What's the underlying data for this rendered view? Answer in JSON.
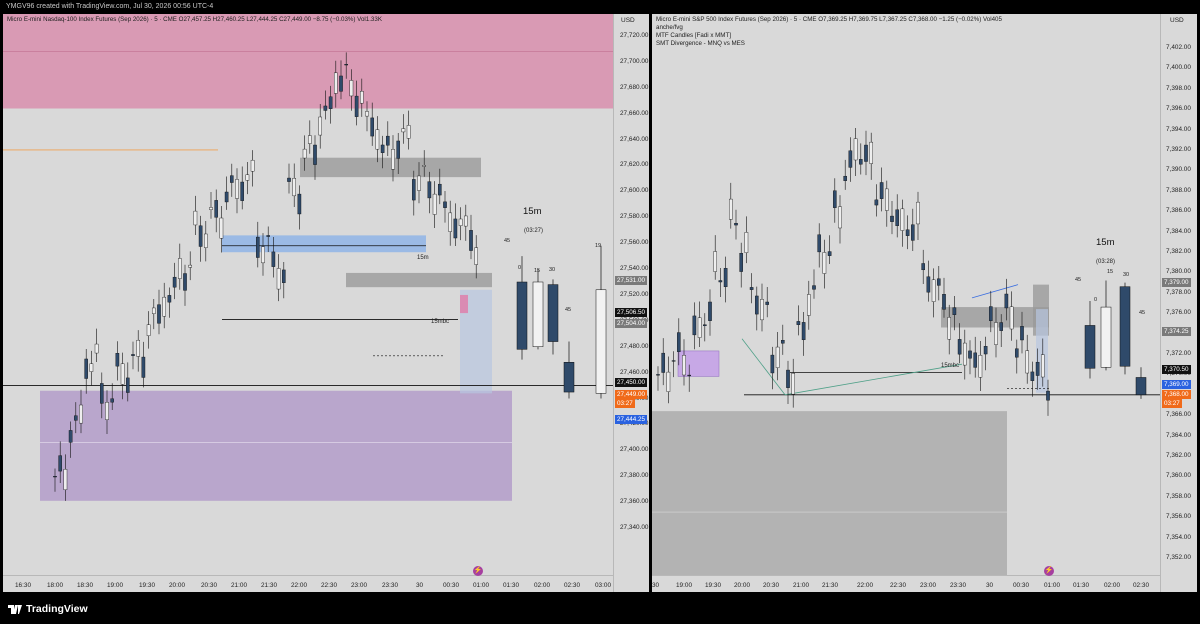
{
  "top_bar": {
    "caption": "YMGV96 created with TradingView.com, Jul 30, 2026 00:56 UTC-4"
  },
  "left_chart": {
    "title": "Micro E-mini Nasdaq-100 Index Futures (Sep 2026) · 5 · CME",
    "ohlc": "O27,457.25 H27,460.25 L27,444.25 C27,449.00 −8.75 (−0.03%) Vol1.33K",
    "currency": "USD",
    "y_labels": [
      "27,720.00",
      "27,700.00",
      "27,680.00",
      "27,660.00",
      "27,640.00",
      "27,620.00",
      "27,600.00",
      "27,580.00",
      "27,560.00",
      "27,540.00",
      "27,520.00",
      "27,500.00",
      "27,480.00",
      "27,460.00",
      "27,440.00",
      "27,420.00",
      "27,400.00",
      "27,380.00",
      "27,360.00",
      "27,340.00"
    ],
    "x_labels": [
      "16:30",
      "18:00",
      "18:30",
      "19:00",
      "19:30",
      "20:00",
      "20:30",
      "21:00",
      "21:30",
      "22:00",
      "22:30",
      "23:00",
      "23:30",
      "30",
      "00:30",
      "01:00",
      "01:30",
      "02:00",
      "02:30",
      "03:00"
    ],
    "price_tags": {
      "p1": "27,531.00",
      "p2": "27,506.50",
      "p3": "27,504.00",
      "p4": "27,450.00",
      "p5": "27,449.00",
      "p6": "03:27",
      "p7": "27,444.25"
    },
    "annotations": {
      "htf_label": "15m",
      "htf_timer": "(03:27)",
      "fvg_tag": "15m",
      "mbc_tag": "15mbc",
      "n45": "45",
      "n0": "0",
      "n15": "15",
      "n30": "30",
      "n45b": "45",
      "n19": "19"
    }
  },
  "right_chart": {
    "title": "Micro E-mini S&P 500 Index Futures (Sep 2026) · 5 · CME",
    "ohlc": "O7,369.25 H7,369.75 L7,367.25 C7,368.00 −1.25 (−0.02%) Vol405",
    "indicators": [
      "anche/fvg",
      "MTF Candles [Fadi x MMT]",
      "SMT Divergence - MNQ vs MES"
    ],
    "currency": "USD",
    "y_labels": [
      "7,402.00",
      "7,400.00",
      "7,398.00",
      "7,396.00",
      "7,394.00",
      "7,392.00",
      "7,390.00",
      "7,388.00",
      "7,386.00",
      "7,384.00",
      "7,382.00",
      "7,380.00",
      "7,378.00",
      "7,376.00",
      "7,374.00",
      "7,372.00",
      "7,370.00",
      "7,368.00",
      "7,366.00",
      "7,364.00",
      "7,362.00",
      "7,360.00",
      "7,358.00",
      "7,356.00",
      "7,354.00",
      "7,352.00"
    ],
    "x_labels": [
      "30",
      "19:00",
      "19:30",
      "20:00",
      "20:30",
      "21:00",
      "21:30",
      "22:00",
      "22:30",
      "23:00",
      "23:30",
      "30",
      "00:30",
      "01:00",
      "01:30",
      "02:00",
      "02:30"
    ],
    "price_tags": {
      "p1": "7,379.00",
      "p2": "7,374.25",
      "p3": "7,370.50",
      "p4": "7,369.00",
      "p5": "7,368.00",
      "p6": "03:27"
    },
    "annotations": {
      "htf_label": "15m",
      "htf_timer": "(03:28)",
      "mbc_tag": "15mbc",
      "n45": "45",
      "n0": "0",
      "n15": "15",
      "n30": "30",
      "n45b": "45"
    }
  },
  "footer": {
    "brand": "TradingView"
  },
  "colors": {
    "bull": "#eeeeee",
    "bear": "#2f4a6a",
    "premium_zone": "#d99ab4",
    "discount_zone": "#b9a6cc",
    "fvg_blue": "#8fb4e6",
    "fvg_gray": "#9a9a9a",
    "last_price": "#f06a1a",
    "blue_tag": "#2a62e0"
  }
}
